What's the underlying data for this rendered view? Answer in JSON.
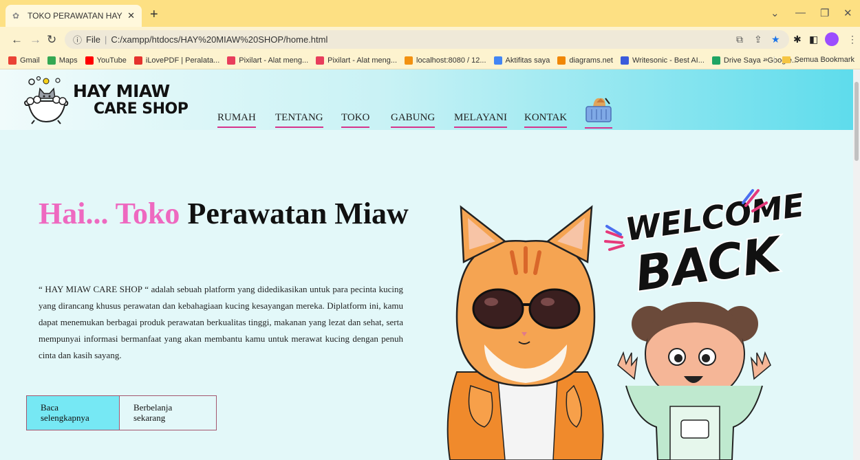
{
  "browser": {
    "tab_title": "TOKO PERAWATAN HAY MIAW.c",
    "url_prefix": "File",
    "url": "C:/xampp/htdocs/HAY%20MIAW%20SHOP/home.html",
    "bookmarks": [
      {
        "label": "Gmail",
        "color": "#ea4335"
      },
      {
        "label": "Maps",
        "color": "#34a853"
      },
      {
        "label": "YouTube",
        "color": "#ff0000"
      },
      {
        "label": "iLovePDF | Peralata...",
        "color": "#e5322d"
      },
      {
        "label": "Pixilart - Alat meng...",
        "color": "#e83e5c"
      },
      {
        "label": "Pixilart - Alat meng...",
        "color": "#e83e5c"
      },
      {
        "label": "localhost:8080 / 12...",
        "color": "#f29111"
      },
      {
        "label": "Aktifitas saya",
        "color": "#4285f4"
      },
      {
        "label": "diagrams.net",
        "color": "#f08705"
      },
      {
        "label": "Writesonic - Best AI...",
        "color": "#3b5bdb"
      },
      {
        "label": "Drive Saya - Google...",
        "color": "#1fa463"
      }
    ],
    "overflow": "»",
    "all_bookmarks": "Semua Bookmark"
  },
  "site": {
    "logo_line1": "HAY MIAW",
    "logo_line2": "CARE SHOP",
    "nav": [
      "RUMAH",
      "TENTANG",
      "TOKO",
      "GABUNG",
      "MELAYANI",
      "KONTAK"
    ],
    "hero_pink": "Hai... Toko",
    "hero_dark": "Perawatan Miaw",
    "description": "“ HAY MIAW CARE SHOP “ adalah sebuah platform yang didedikasikan untuk para pecinta kucing yang dirancang khusus perawatan dan kebahagiaan kucing kesayangan mereka. Diplatform ini, kamu dapat menemukan berbagai produk perawatan berkualitas tinggi, makanan yang lezat dan sehat, serta mempunyai informasi bermanfaat yang akan membantu kamu untuk merawat kucing dengan penuh cinta dan kasih sayang.",
    "btn_primary_line1": "Baca",
    "btn_primary_line2": "selengkapnya",
    "btn_secondary_line1": "Berbelanja",
    "btn_secondary_line2": "sekarang",
    "welcome_line1": "WELCOME",
    "welcome_line2": "BACK"
  },
  "colors": {
    "accent_pink": "#ee69c0",
    "nav_underline": "#d6338c",
    "page_bg": "#e3f8f9",
    "header_end": "#5edcec",
    "primary_button": "#76e8f4"
  }
}
